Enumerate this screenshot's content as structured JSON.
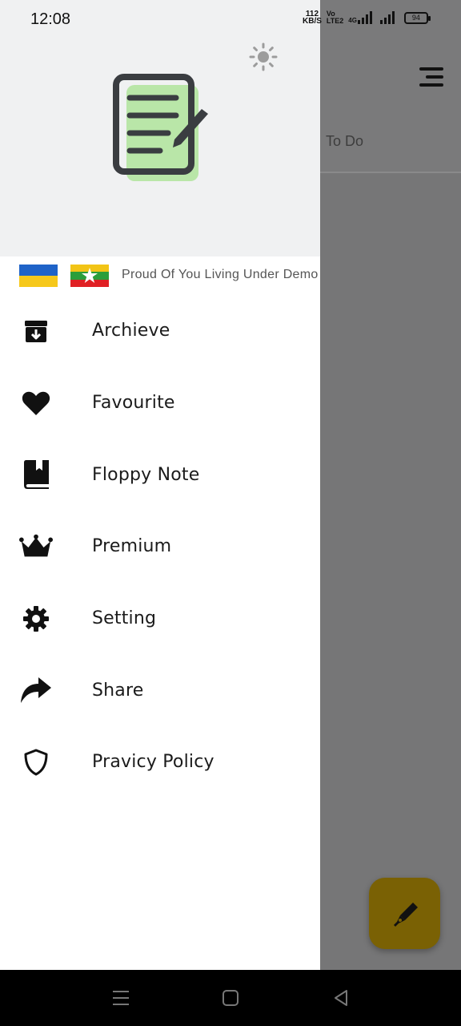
{
  "status_bar": {
    "time": "12:08",
    "net_speed_value": "112",
    "net_speed_unit": "KB/S",
    "volte_top": "Vo",
    "volte_bottom": "LTE2",
    "network_type": "4G",
    "battery_level": "94"
  },
  "drawer": {
    "theme_toggle_icon": "sun-icon",
    "logo_icon": "note-edit-icon",
    "banner_text": "Proud Of You Living Under Demo",
    "menu": [
      {
        "label": "Archieve",
        "icon": "archive-icon"
      },
      {
        "label": "Favourite",
        "icon": "heart-icon"
      },
      {
        "label": "Floppy Note",
        "icon": "book-icon"
      },
      {
        "label": "Premium",
        "icon": "crown-icon"
      },
      {
        "label": "Setting",
        "icon": "gear-icon"
      },
      {
        "label": "Share",
        "icon": "share-icon"
      },
      {
        "label": "Pravicy Policy",
        "icon": "shield-icon"
      }
    ]
  },
  "app": {
    "tab_label": "To Do",
    "menu_icon": "menu-icon",
    "fab_icon": "pen-icon"
  },
  "colors": {
    "drawer_header_bg": "#f0f1f2",
    "logo_accent": "#b9e6a8",
    "fab": "#7a6104",
    "scrim": "#767677"
  }
}
